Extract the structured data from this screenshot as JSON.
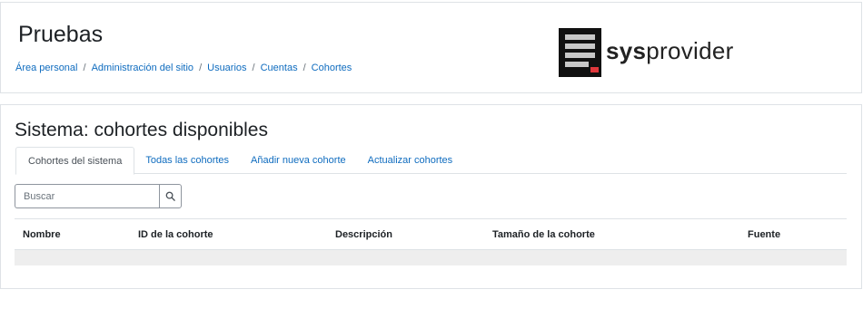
{
  "header": {
    "title": "Pruebas",
    "breadcrumb": [
      "Área personal",
      "Administración del sitio",
      "Usuarios",
      "Cuentas",
      "Cohortes"
    ],
    "breadcrumb_separator": "/",
    "logo": {
      "bold": "sys",
      "regular": "provider",
      "accent": "#e0383c"
    }
  },
  "main": {
    "title": "Sistema: cohortes disponibles",
    "tabs": [
      {
        "label": "Cohortes del sistema",
        "active": true
      },
      {
        "label": "Todas las cohortes",
        "active": false
      },
      {
        "label": "Añadir nueva cohorte",
        "active": false
      },
      {
        "label": "Actualizar cohortes",
        "active": false
      }
    ],
    "search": {
      "placeholder": "Buscar",
      "value": ""
    },
    "table": {
      "columns": [
        "Nombre",
        "ID de la cohorte",
        "Descripción",
        "Tamaño de la cohorte",
        "Fuente"
      ],
      "rows": []
    }
  },
  "colors": {
    "link": "#0f6cbf",
    "border": "#dee2e6",
    "text": "#1d2125"
  }
}
